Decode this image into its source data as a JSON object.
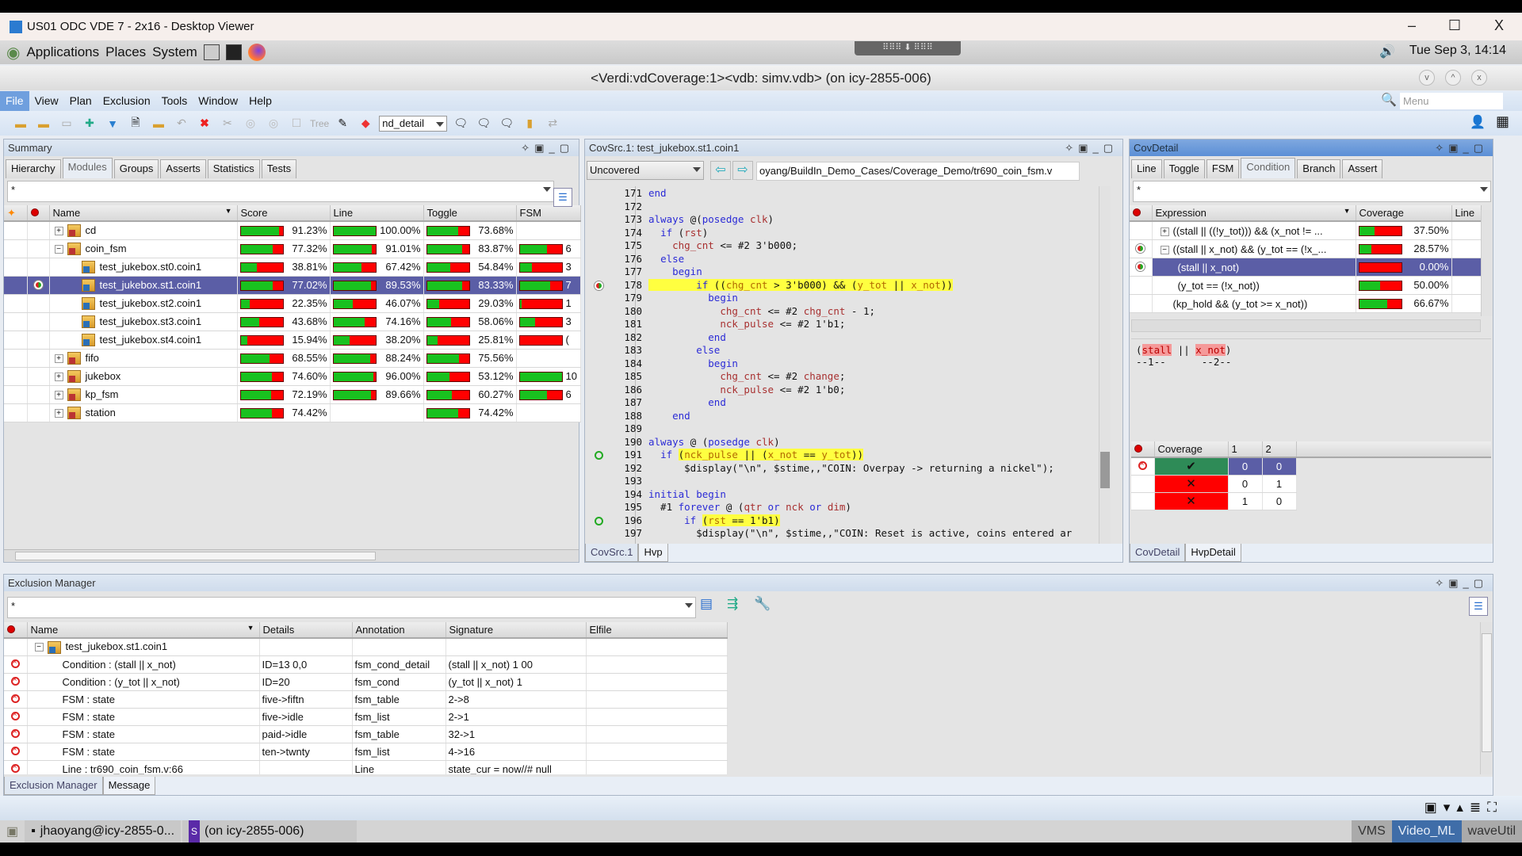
{
  "window": {
    "title": "US01 ODC VDE 7 - 2x16 - Desktop Viewer",
    "controls": [
      "–",
      "☐",
      "X"
    ]
  },
  "panel": {
    "menus": [
      "Applications",
      "Places",
      "System"
    ],
    "clock": "Tue Sep  3, 14:14"
  },
  "app": {
    "title": "<Verdi:vdCoverage:1><vdb: simv.vdb> (on icy-2855-006)",
    "menu": [
      "File",
      "View",
      "Plan",
      "Exclusion",
      "Tools",
      "Window",
      "Help"
    ],
    "menu_search_placeholder": "Menu",
    "toolbar_combo": "nd_detail",
    "toolbar_tree": "Tree"
  },
  "summary": {
    "title": "Summary",
    "tabs": [
      "Hierarchy",
      "Modules",
      "Groups",
      "Asserts",
      "Statistics",
      "Tests"
    ],
    "selected_tab": "Modules",
    "filter": "*",
    "columns": [
      "Name",
      "Score",
      "Line",
      "Toggle",
      "FSM"
    ],
    "rows": [
      {
        "name": "cd",
        "level": 0,
        "fold": "+",
        "type": "module",
        "score": 91.23,
        "line": 100.0,
        "toggle": 73.68,
        "fsm": null,
        "fsm_text": ""
      },
      {
        "name": "coin_fsm",
        "level": 0,
        "fold": "-",
        "type": "module",
        "score": 77.32,
        "line": 91.01,
        "toggle": 83.87,
        "fsm": 66,
        "fsm_text": "6"
      },
      {
        "name": "test_jukebox.st0.coin1",
        "level": 1,
        "type": "instance",
        "score": 38.81,
        "line": 67.42,
        "toggle": 54.84,
        "fsm": 30,
        "fsm_text": "3"
      },
      {
        "name": "test_jukebox.st1.coin1",
        "level": 1,
        "type": "instance",
        "selected": true,
        "marker": "partial",
        "score": 77.02,
        "line": 89.53,
        "toggle": 83.33,
        "fsm": 72,
        "fsm_text": "7"
      },
      {
        "name": "test_jukebox.st2.coin1",
        "level": 1,
        "type": "instance",
        "score": 22.35,
        "line": 46.07,
        "toggle": 29.03,
        "fsm": 5,
        "fsm_text": "1"
      },
      {
        "name": "test_jukebox.st3.coin1",
        "level": 1,
        "type": "instance",
        "score": 43.68,
        "line": 74.16,
        "toggle": 58.06,
        "fsm": 36,
        "fsm_text": "3"
      },
      {
        "name": "test_jukebox.st4.coin1",
        "level": 1,
        "type": "instance",
        "score": 15.94,
        "line": 38.2,
        "toggle": 25.81,
        "fsm": 0,
        "fsm_text": "("
      },
      {
        "name": "fifo",
        "level": 0,
        "fold": "+",
        "type": "module",
        "score": 68.55,
        "line": 88.24,
        "toggle": 75.56,
        "fsm": null,
        "fsm_text": ""
      },
      {
        "name": "jukebox",
        "level": 0,
        "fold": "+",
        "type": "module",
        "score": 74.6,
        "line": 96.0,
        "toggle": 53.12,
        "fsm": 100,
        "fsm_text": "10"
      },
      {
        "name": "kp_fsm",
        "level": 0,
        "fold": "+",
        "type": "module",
        "score": 72.19,
        "line": 89.66,
        "toggle": 60.27,
        "fsm": 66,
        "fsm_text": "6"
      },
      {
        "name": "station",
        "level": 0,
        "fold": "+",
        "type": "module",
        "score": 74.42,
        "line": null,
        "toggle": 74.42,
        "fsm": null,
        "fsm_text": ""
      }
    ]
  },
  "covsrc": {
    "title": "CovSrc.1: test_jukebox.st1.coin1",
    "filter": "Uncovered",
    "path": "oyang/BuildIn_Demo_Cases/Coverage_Demo/tr690_coin_fsm.v",
    "tabs": [
      "CovSrc.1",
      "Hvp"
    ],
    "lines": [
      {
        "n": "171",
        "t": [
          [
            "k",
            "end"
          ]
        ]
      },
      {
        "n": "172",
        "t": []
      },
      {
        "n": "173",
        "t": [
          [
            "k",
            "always"
          ],
          [
            "p",
            " @("
          ],
          [
            "k",
            "posedge"
          ],
          [
            "p",
            " "
          ],
          [
            "v",
            "clk"
          ],
          [
            "p",
            ")"
          ]
        ]
      },
      {
        "n": "174",
        "t": [
          [
            "p",
            "  "
          ],
          [
            "k",
            "if"
          ],
          [
            "p",
            " ("
          ],
          [
            "v",
            "rst"
          ],
          [
            "p",
            ")"
          ]
        ]
      },
      {
        "n": "175",
        "t": [
          [
            "p",
            "    "
          ],
          [
            "v",
            "chg_cnt"
          ],
          [
            "p",
            " <= #2 3'b000;"
          ]
        ]
      },
      {
        "n": "176",
        "t": [
          [
            "p",
            "  "
          ],
          [
            "k",
            "else"
          ]
        ]
      },
      {
        "n": "177",
        "t": [
          [
            "p",
            "    "
          ],
          [
            "k",
            "begin"
          ]
        ]
      },
      {
        "n": "178",
        "m": "partial",
        "t": [
          [
            "h",
            "        "
          ],
          [
            "hk",
            "if"
          ],
          [
            "h",
            " (("
          ],
          [
            "hv",
            "chg_cnt"
          ],
          [
            "h",
            " > 3'b000) && ("
          ],
          [
            "hv",
            "y_tot"
          ],
          [
            "h",
            " || "
          ],
          [
            "hv",
            "x_not"
          ],
          [
            "h",
            "))"
          ]
        ]
      },
      {
        "n": "179",
        "t": [
          [
            "p",
            "          "
          ],
          [
            "k",
            "begin"
          ]
        ]
      },
      {
        "n": "180",
        "t": [
          [
            "p",
            "            "
          ],
          [
            "v",
            "chg_cnt"
          ],
          [
            "p",
            " <= #2 "
          ],
          [
            "v",
            "chg_cnt"
          ],
          [
            "p",
            " - 1;"
          ]
        ]
      },
      {
        "n": "181",
        "t": [
          [
            "p",
            "            "
          ],
          [
            "v",
            "nck_pulse"
          ],
          [
            "p",
            " <= #2 1'b1;"
          ]
        ]
      },
      {
        "n": "182",
        "t": [
          [
            "p",
            "          "
          ],
          [
            "k",
            "end"
          ]
        ]
      },
      {
        "n": "183",
        "t": [
          [
            "p",
            "        "
          ],
          [
            "k",
            "else"
          ]
        ]
      },
      {
        "n": "184",
        "t": [
          [
            "p",
            "          "
          ],
          [
            "k",
            "begin"
          ]
        ]
      },
      {
        "n": "185",
        "t": [
          [
            "p",
            "            "
          ],
          [
            "v",
            "chg_cnt"
          ],
          [
            "p",
            " <= #2 "
          ],
          [
            "v",
            "change"
          ],
          [
            "p",
            ";"
          ]
        ]
      },
      {
        "n": "186",
        "t": [
          [
            "p",
            "            "
          ],
          [
            "v",
            "nck_pulse"
          ],
          [
            "p",
            " <= #2 1'b0;"
          ]
        ]
      },
      {
        "n": "187",
        "t": [
          [
            "p",
            "          "
          ],
          [
            "k",
            "end"
          ]
        ]
      },
      {
        "n": "188",
        "t": [
          [
            "p",
            "    "
          ],
          [
            "k",
            "end"
          ]
        ]
      },
      {
        "n": "189",
        "t": []
      },
      {
        "n": "190",
        "t": [
          [
            "k",
            "always"
          ],
          [
            "p",
            " @ ("
          ],
          [
            "k",
            "posedge"
          ],
          [
            "p",
            " "
          ],
          [
            "v",
            "clk"
          ],
          [
            "p",
            ")"
          ]
        ]
      },
      {
        "n": "191",
        "m": "covered",
        "t": [
          [
            "p",
            "  "
          ],
          [
            "k",
            "if"
          ],
          [
            "p",
            " "
          ],
          [
            "h",
            "("
          ],
          [
            "hv",
            "nck_pulse"
          ],
          [
            "h",
            " || ("
          ],
          [
            "hv",
            "x_not"
          ],
          [
            "h",
            " == "
          ],
          [
            "hv",
            "y_tot"
          ],
          [
            "h",
            "))"
          ]
        ]
      },
      {
        "n": "192",
        "t": [
          [
            "p",
            "      $display(\"\\n\", $stime,,\"COIN: Overpay -> returning a nickel\");"
          ]
        ]
      },
      {
        "n": "193",
        "t": []
      },
      {
        "n": "194",
        "t": [
          [
            "k",
            "initial"
          ],
          [
            "p",
            " "
          ],
          [
            "k",
            "begin"
          ]
        ]
      },
      {
        "n": "195",
        "t": [
          [
            "p",
            "  #1 "
          ],
          [
            "k",
            "forever"
          ],
          [
            "p",
            " @ ("
          ],
          [
            "v",
            "qtr"
          ],
          [
            "p",
            " "
          ],
          [
            "k",
            "or"
          ],
          [
            "p",
            " "
          ],
          [
            "v",
            "nck"
          ],
          [
            "p",
            " "
          ],
          [
            "k",
            "or"
          ],
          [
            "p",
            " "
          ],
          [
            "v",
            "dim"
          ],
          [
            "p",
            ")"
          ]
        ]
      },
      {
        "n": "196",
        "m": "covered",
        "t": [
          [
            "p",
            "      "
          ],
          [
            "k",
            "if"
          ],
          [
            "p",
            " "
          ],
          [
            "h",
            "("
          ],
          [
            "hv",
            "rst"
          ],
          [
            "h",
            " == 1'b1)"
          ]
        ]
      },
      {
        "n": "197",
        "t": [
          [
            "p",
            "        $display(\"\\n\", $stime,,\"COIN: Reset is active, coins entered ar"
          ]
        ]
      }
    ]
  },
  "covdetail": {
    "title": "CovDetail",
    "tabs": [
      "Line",
      "Toggle",
      "FSM",
      "Condition",
      "Branch",
      "Assert"
    ],
    "selected_tab": "Condition",
    "filter": "*",
    "columns": [
      "Expression",
      "Coverage",
      "Line"
    ],
    "rows": [
      {
        "expr": "((stall || ((!y_tot))) && (x_not != ...",
        "level": 0,
        "fold": "+",
        "cov": 37.5
      },
      {
        "expr": "((stall || x_not) && (y_tot == (!x_...",
        "level": 0,
        "fold": "-",
        "cov": 28.57,
        "marker": "partial"
      },
      {
        "expr": "(stall || x_not)",
        "level": 1,
        "cov": 0.0,
        "marker": "partial",
        "selected": true
      },
      {
        "expr": "(y_tot == (!x_not))",
        "level": 1,
        "cov": 50.0
      },
      {
        "expr": "(kp_hold && (y_tot >= x_not))",
        "level": 0,
        "cov": 66.67
      }
    ],
    "expression": {
      "parts": [
        "(",
        "stall",
        " || ",
        "x_not",
        ")"
      ],
      "labels": "--1--      --2--"
    },
    "cov_table": {
      "columns": [
        "Coverage",
        "1",
        "2"
      ],
      "rows": [
        {
          "status": "covered",
          "glyph": "✔",
          "v": [
            "0",
            "0"
          ],
          "excluded": true
        },
        {
          "status": "uncovered",
          "glyph": "✕",
          "v": [
            "0",
            "1"
          ]
        },
        {
          "status": "uncovered",
          "glyph": "✕",
          "v": [
            "1",
            "0"
          ]
        }
      ]
    },
    "bottom_tabs": [
      "CovDetail",
      "HvpDetail"
    ]
  },
  "exclusion": {
    "title": "Exclusion Manager",
    "filter": "*",
    "columns": [
      "Name",
      "Details",
      "Annotation",
      "Signature",
      "Elfile"
    ],
    "root": "test_jukebox.st1.coin1",
    "rows": [
      {
        "name": "Condition : (stall || x_not)",
        "details": "ID=13  0,0",
        "annotation": "fsm_cond_detail",
        "signature": "(stall || x_not) 1 00",
        "elfile": ""
      },
      {
        "name": "Condition : (y_tot || x_not)",
        "details": "ID=20",
        "annotation": "fsm_cond",
        "signature": "(y_tot || x_not) 1",
        "elfile": ""
      },
      {
        "name": "FSM : state",
        "details": "five->fiftn",
        "annotation": "fsm_table",
        "signature": "2->8",
        "elfile": ""
      },
      {
        "name": "FSM : state",
        "details": "five->idle",
        "annotation": "fsm_list",
        "signature": "2->1",
        "elfile": ""
      },
      {
        "name": "FSM : state",
        "details": "paid->idle",
        "annotation": "fsm_table",
        "signature": "32->1",
        "elfile": ""
      },
      {
        "name": "FSM : state",
        "details": "ten->twnty",
        "annotation": "fsm_list",
        "signature": "4->16",
        "elfile": ""
      },
      {
        "name": "Line : tr690_coin_fsm.v:66",
        "details": "",
        "annotation": "Line",
        "signature": "state_cur = now//# null",
        "elfile": ""
      }
    ],
    "tabs": [
      "Exclusion Manager",
      "Message"
    ]
  },
  "taskbar": {
    "tasks": [
      "jhaoyang@icy-2855-0...",
      "(on icy-2855-006)"
    ],
    "workspaces": [
      "VMS",
      "Video_ML",
      "waveUtil"
    ],
    "active_workspace": "Video_ML"
  },
  "colors": {
    "covered": "#19c11f",
    "uncovered": "#ff0000",
    "selection": "#5b5ea6",
    "highlight": "#ffff40",
    "covered_cell": "#2e8b57"
  }
}
